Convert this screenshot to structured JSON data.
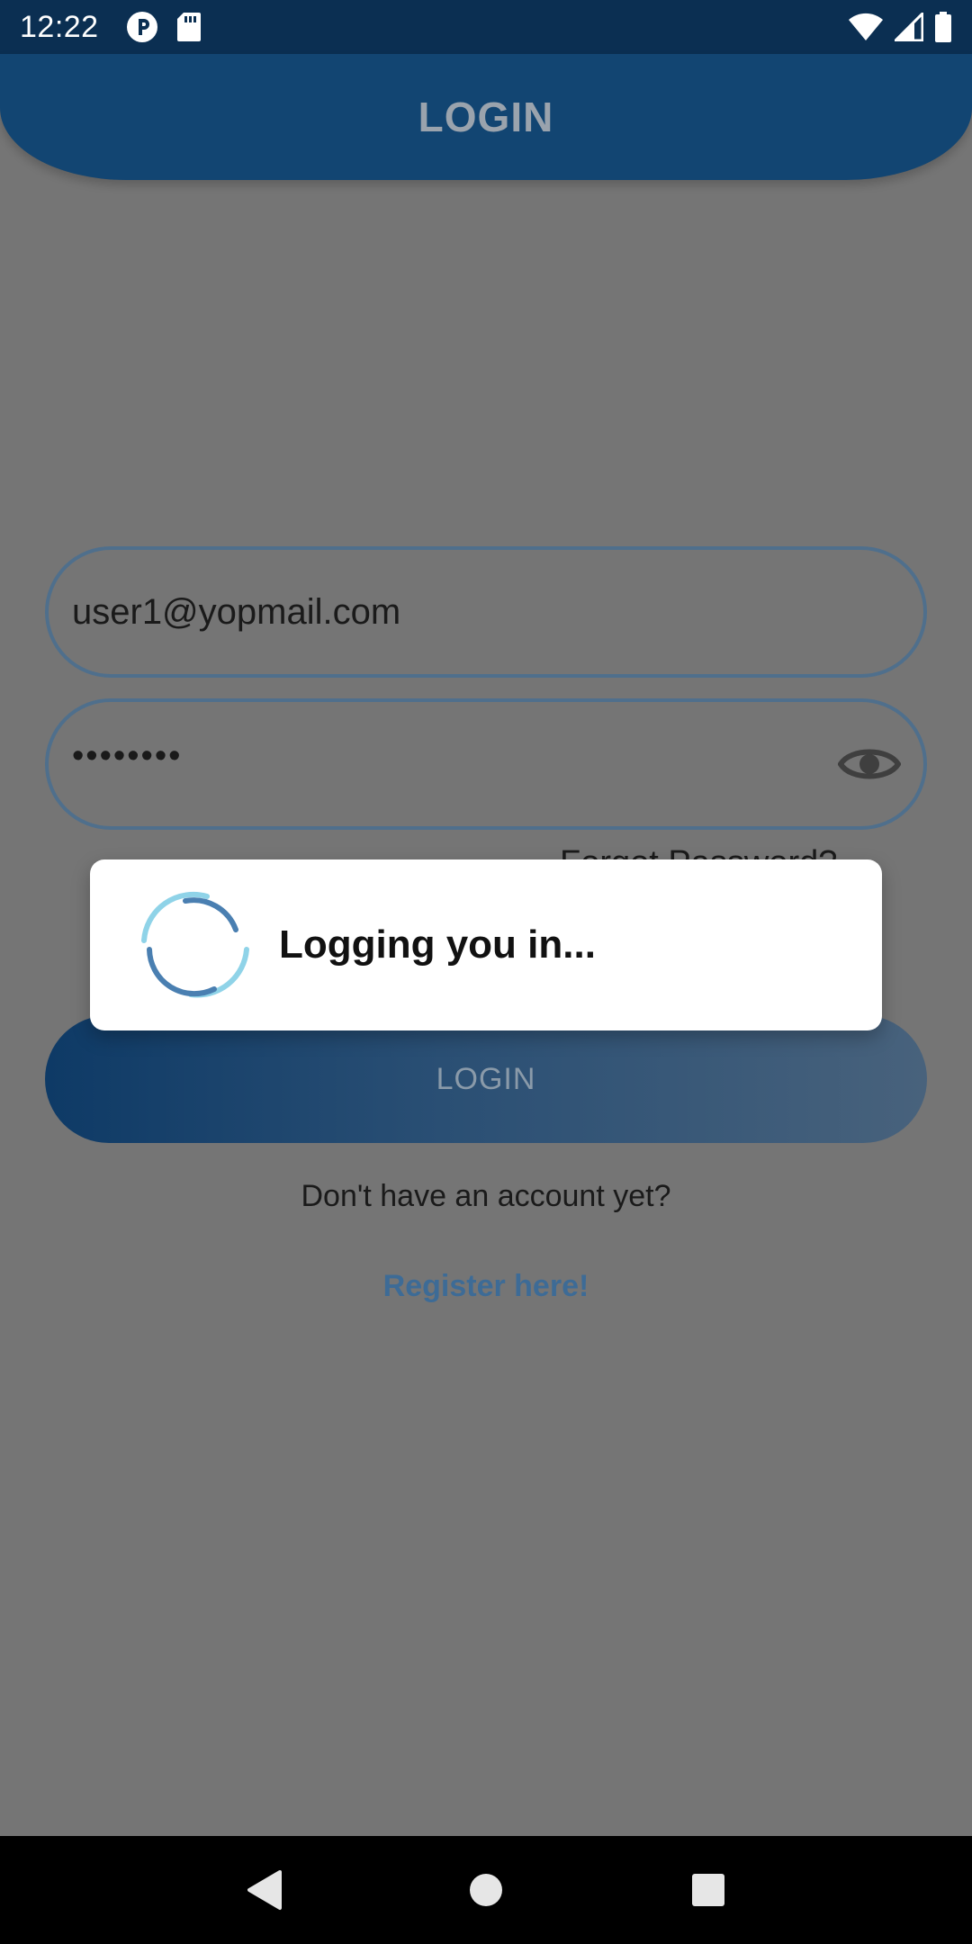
{
  "status_bar": {
    "time": "12:22",
    "icons": [
      "pocket-app-icon",
      "sd-card-icon",
      "wifi-icon",
      "signal-icon",
      "battery-icon"
    ]
  },
  "app_bar": {
    "title": "LOGIN"
  },
  "form": {
    "email_value": "user1@yopmail.com",
    "password_value": "••••••••",
    "forgot_password_label": "Forgot Password?",
    "login_button_label": "LOGIN",
    "no_account_text": "Don't have an account yet?",
    "register_link_label": "Register here!"
  },
  "dialog": {
    "message": "Logging you in..."
  },
  "nav_bar": {
    "buttons": [
      "back-icon",
      "home-icon",
      "recents-icon"
    ]
  },
  "colors": {
    "status_bar": "#0b2f52",
    "app_bar": "#124572",
    "overlay_background": "#757575",
    "field_border": "#4f6f8c",
    "link": "#3d6b96",
    "spinner_dark": "#4a7fb1",
    "spinner_light": "#8fd3e8"
  }
}
